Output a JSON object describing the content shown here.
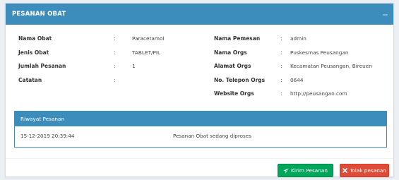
{
  "panel": {
    "title": "PESANAN OBAT"
  },
  "left_fields": [
    {
      "label": "Nama Obat",
      "value": "Paracetamol"
    },
    {
      "label": "Jenis Obat",
      "value": "TABLET/PIL"
    },
    {
      "label": "Jumlah Pesanan",
      "value": "1"
    },
    {
      "label": "Catatan",
      "value": ""
    }
  ],
  "right_fields": [
    {
      "label": "Nama Pemesan",
      "value": "admin"
    },
    {
      "label": "Nama Orgs",
      "value": "Puskesmas Peusangan"
    },
    {
      "label": "Alamat Orgs",
      "value": "Kecamatan Peusangan, Bireuen"
    },
    {
      "label": "No. Telepon Orgs",
      "value": "0644"
    },
    {
      "label": "Website Orgs",
      "value": "http://peusangan.com"
    }
  ],
  "separator": ":",
  "history": {
    "title": "Riwayat Pesanan",
    "rows": [
      {
        "date": "15-12-2019 20:39:44",
        "status": "Pesanan Obat sedang diproses"
      }
    ]
  },
  "buttons": {
    "send_label": "Kirim Pesanan",
    "reject_label": "Tolak pesanan"
  },
  "colors": {
    "header": "#3c8dbc",
    "send": "#00a65a",
    "reject": "#dd4b39"
  },
  "icons": {
    "send": "paper-plane-icon",
    "reject": "close-icon",
    "collapse": "minus-icon"
  }
}
